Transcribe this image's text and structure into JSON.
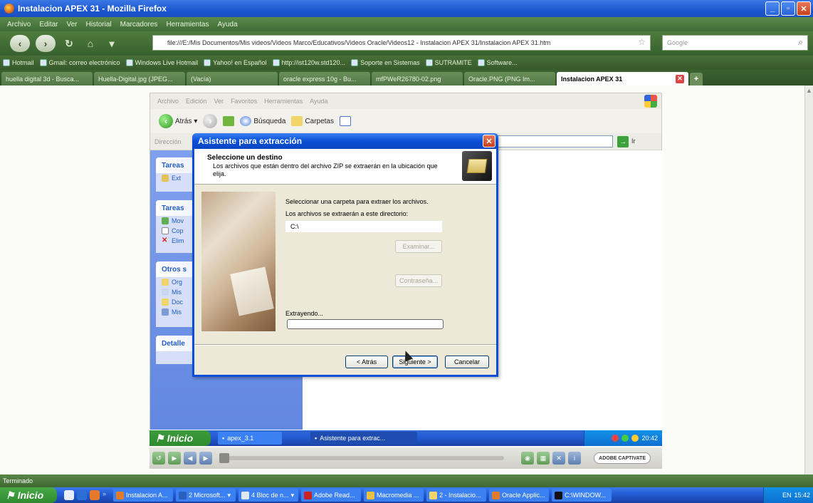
{
  "firefox": {
    "title": "Instalacion APEX 31 - Mozilla Firefox",
    "menu": [
      "Archivo",
      "Editar",
      "Ver",
      "Historial",
      "Marcadores",
      "Herramientas",
      "Ayuda"
    ],
    "url": "file:///E:/Mis Documentos/Mis videos/Videos Marco/Educativos/Videos Oracle/Videos12 - Instalacion APEX 31/Instalacion APEX 31.htm",
    "search_placeholder": "Google",
    "bookmarks": [
      "Hotmail",
      "Gmail: correo electrónico",
      "Windows Live Hotmail",
      "Yahoo! en Español",
      "http://ist120w.std120...",
      "Soporte en Sistemas",
      "SUTRAMITE",
      "Software..."
    ],
    "tabs": [
      "huella digital 3d - Busca...",
      "Huella-Digital.jpg (JPEG...",
      "(Vacía)",
      "oracle express 10g - Bu...",
      "mfPWeR26780-02.png",
      "Oracle.PNG (PNG Im..."
    ],
    "active_tab": "Instalacion APEX 31",
    "status": "Terminado"
  },
  "explorer": {
    "menu": [
      "Archivo",
      "Edición",
      "Ver",
      "Favoritos",
      "Herramientas",
      "Ayuda"
    ],
    "toolbar": {
      "back": "Atrás",
      "search": "Búsqueda",
      "folders": "Carpetas"
    },
    "address_label": "Dirección",
    "go_label": "Ir",
    "left_pane": [
      {
        "title": "Tareas",
        "items": [
          "Ext"
        ]
      },
      {
        "title": "Tareas",
        "items": [
          "Mov",
          "Cop",
          "Elim"
        ]
      },
      {
        "title": "Otros s",
        "items": [
          "Org",
          "Mis",
          "Doc",
          "Mis"
        ]
      },
      {
        "title": "Detalle",
        "items": []
      }
    ]
  },
  "wizard": {
    "title": "Asistente para extracción",
    "header_title": "Seleccione un destino",
    "header_subtitle": "Los archivos que están dentro del archivo ZIP se extraerán en la ubicación que elija.",
    "label_select": "Seleccionar una carpeta para extraer los archivos.",
    "label_dir": "Los archivos se extraerán a este directorio:",
    "directory_value": "C:\\",
    "browse_button": "Examinar...",
    "password_button": "Contraseña...",
    "progress_label": "Extrayendo...",
    "progress": 0.0,
    "back_button": "< Atrás",
    "next_button": "Siguiente >",
    "cancel_button": "Cancelar"
  },
  "inner_taskbar": {
    "start": "Inicio",
    "items": [
      "apex_3.1",
      "Asistente para extrac..."
    ],
    "clock": "20:42"
  },
  "captivate": {
    "logo": "ADOBE CAPTIVATE"
  },
  "outer_taskbar": {
    "start": "Inicio",
    "items": [
      "Instalacion A...",
      "2 Microsoft...",
      "4 Bloc de n...",
      "Adobe Read...",
      "Macromedia ...",
      "2 - Instalacio...",
      "Oracle Applic...",
      "C:\\WINDOW..."
    ],
    "lang": "EN",
    "clock": "15:42"
  }
}
